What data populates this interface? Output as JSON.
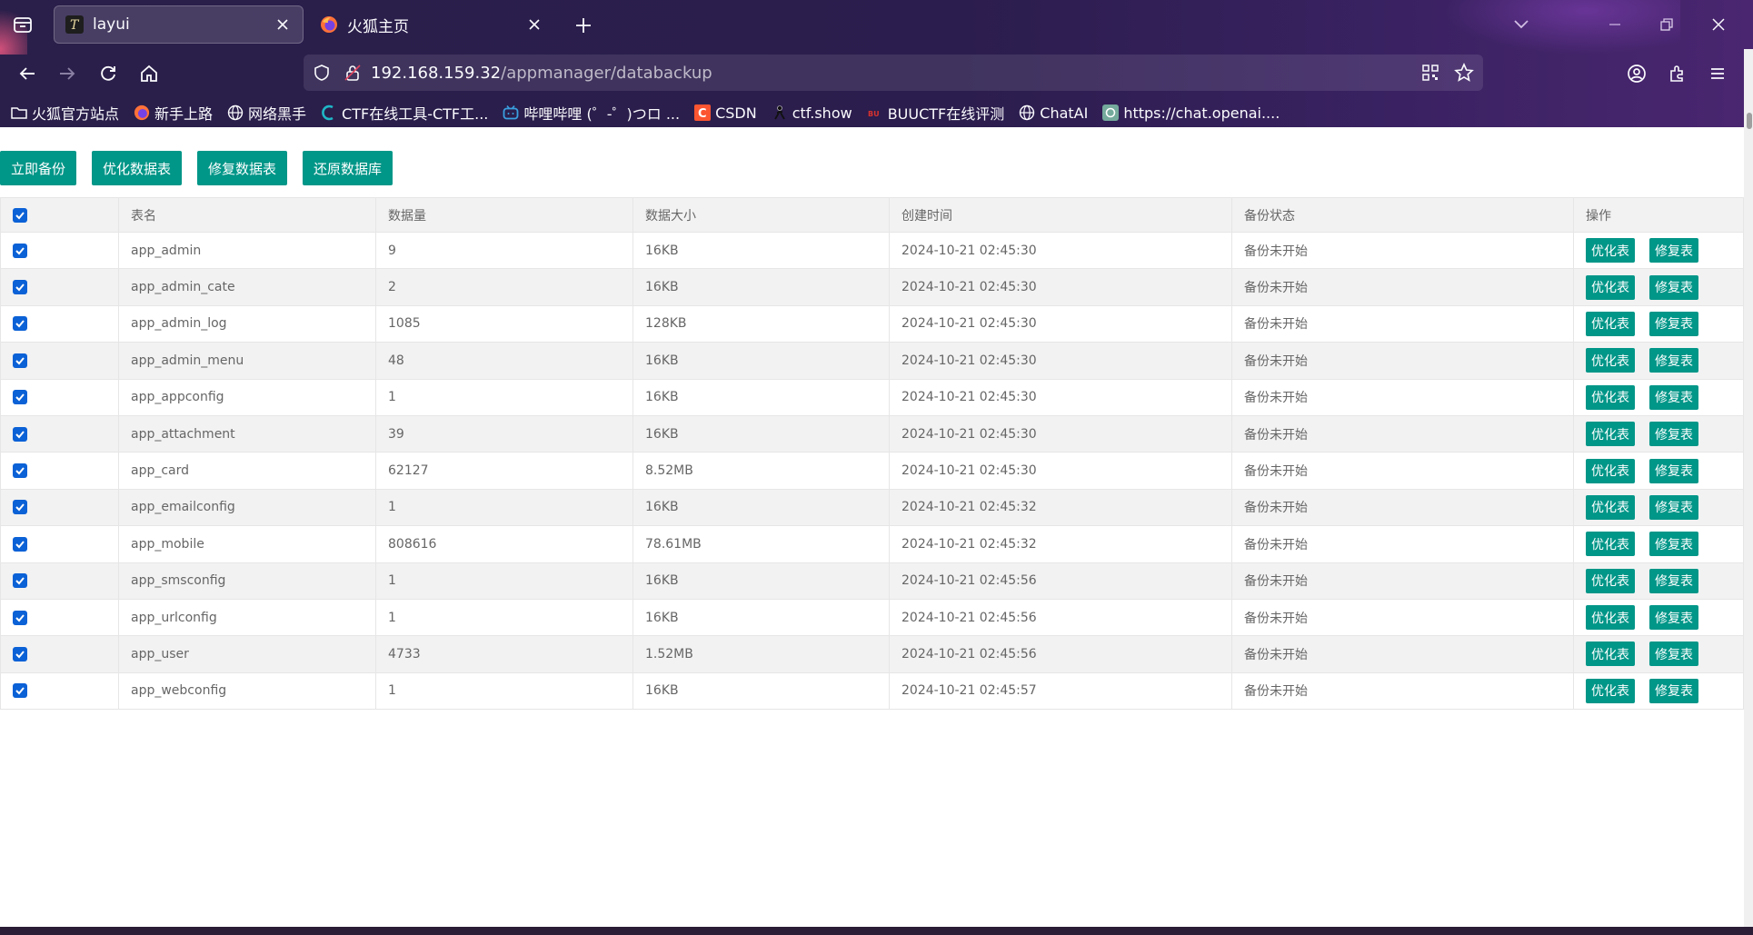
{
  "browser": {
    "tabs": [
      {
        "title": "layui",
        "active": true
      },
      {
        "title": "火狐主页",
        "active": false
      }
    ],
    "url": {
      "host": "192.168.159.32",
      "path": "/appmanager/databackup"
    },
    "bookmarks": [
      {
        "label": "火狐官方站点",
        "icon": "folder-icon"
      },
      {
        "label": "新手上路",
        "icon": "firefox-icon"
      },
      {
        "label": "网络黑手",
        "icon": "globe-icon"
      },
      {
        "label": "CTF在线工具-CTF工...",
        "icon": "ctf-icon"
      },
      {
        "label": "哔哩哔哩 (゜-゜)つロ ...",
        "icon": "bilibili-icon"
      },
      {
        "label": "CSDN",
        "icon": "csdn-icon"
      },
      {
        "label": "ctf.show",
        "icon": "ctfshow-icon"
      },
      {
        "label": "BUUCTF在线评测",
        "icon": "buuctf-icon"
      },
      {
        "label": "ChatAI",
        "icon": "globe-icon"
      },
      {
        "label": "https://chat.openai....",
        "icon": "openai-icon"
      }
    ]
  },
  "toolbar": {
    "backup_now": "立即备份",
    "optimize_tables": "优化数据表",
    "repair_tables": "修复数据表",
    "restore_db": "还原数据库"
  },
  "table": {
    "headers": {
      "name": "表名",
      "count": "数据量",
      "size": "数据大小",
      "created": "创建时间",
      "status": "备份状态",
      "ops": "操作"
    },
    "op_optimize": "优化表",
    "op_repair": "修复表",
    "rows": [
      {
        "name": "app_admin",
        "count": "9",
        "size": "16KB",
        "created": "2024-10-21 02:45:30",
        "status": "备份未开始"
      },
      {
        "name": "app_admin_cate",
        "count": "2",
        "size": "16KB",
        "created": "2024-10-21 02:45:30",
        "status": "备份未开始"
      },
      {
        "name": "app_admin_log",
        "count": "1085",
        "size": "128KB",
        "created": "2024-10-21 02:45:30",
        "status": "备份未开始"
      },
      {
        "name": "app_admin_menu",
        "count": "48",
        "size": "16KB",
        "created": "2024-10-21 02:45:30",
        "status": "备份未开始"
      },
      {
        "name": "app_appconfig",
        "count": "1",
        "size": "16KB",
        "created": "2024-10-21 02:45:30",
        "status": "备份未开始"
      },
      {
        "name": "app_attachment",
        "count": "39",
        "size": "16KB",
        "created": "2024-10-21 02:45:30",
        "status": "备份未开始"
      },
      {
        "name": "app_card",
        "count": "62127",
        "size": "8.52MB",
        "created": "2024-10-21 02:45:30",
        "status": "备份未开始"
      },
      {
        "name": "app_emailconfig",
        "count": "1",
        "size": "16KB",
        "created": "2024-10-21 02:45:32",
        "status": "备份未开始"
      },
      {
        "name": "app_mobile",
        "count": "808616",
        "size": "78.61MB",
        "created": "2024-10-21 02:45:32",
        "status": "备份未开始"
      },
      {
        "name": "app_smsconfig",
        "count": "1",
        "size": "16KB",
        "created": "2024-10-21 02:45:56",
        "status": "备份未开始"
      },
      {
        "name": "app_urlconfig",
        "count": "1",
        "size": "16KB",
        "created": "2024-10-21 02:45:56",
        "status": "备份未开始"
      },
      {
        "name": "app_user",
        "count": "4733",
        "size": "1.52MB",
        "created": "2024-10-21 02:45:56",
        "status": "备份未开始"
      },
      {
        "name": "app_webconfig",
        "count": "1",
        "size": "16KB",
        "created": "2024-10-21 02:45:57",
        "status": "备份未开始"
      }
    ]
  },
  "colors": {
    "accent": "#009688",
    "checkbox": "#0b61d6",
    "chrome": "#2b1d4d"
  }
}
